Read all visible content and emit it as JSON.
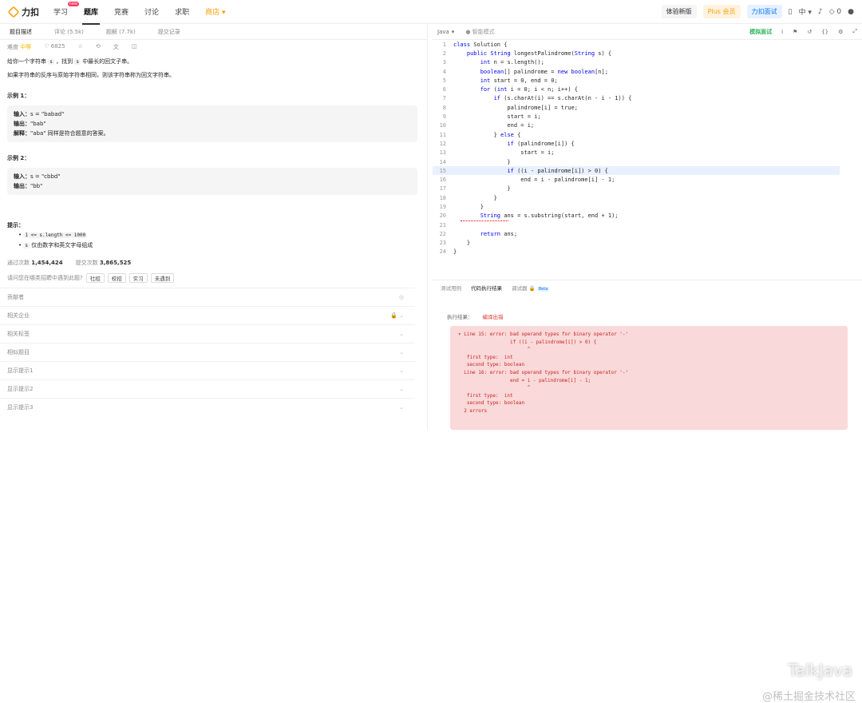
{
  "topbar": {
    "logo": "力扣",
    "nav": [
      "学习",
      "题库",
      "竞赛",
      "讨论",
      "求职",
      "商店"
    ],
    "new_badge": "new",
    "experience": "体验新版",
    "plus": "Plus 会员",
    "interview": "力扣面试",
    "lang": "中",
    "points": "0"
  },
  "left": {
    "tabs": [
      "题目描述",
      "评论 (5.5k)",
      "题解 (7.7k)",
      "提交记录"
    ],
    "difficulty_label": "难度",
    "difficulty": "中等",
    "likes": "6825",
    "description": [
      "给你一个字符串",
      "s",
      "，找到",
      "s",
      "中最长的回文子串。"
    ],
    "definition": "如果字符串的反序与原始字符串相同，则该字符串称为回文字符串。",
    "ex1_title": "示例 1：",
    "ex1": {
      "in_label": "输入：",
      "in": "s = \"babad\"",
      "out_label": "输出：",
      "out": "\"bab\"",
      "exp_label": "解释：",
      "exp": "\"aba\" 同样是符合题意的答案。"
    },
    "ex2_title": "示例 2：",
    "ex2": {
      "in_label": "输入：",
      "in": "s = \"cbbd\"",
      "out_label": "输出：",
      "out": "\"bb\""
    },
    "hint_title": "提示：",
    "hints": [
      "1 <= s.length <= 1000",
      "仅由数字和英文字母组成"
    ],
    "hint_s": "s",
    "pass_label": "通过次数",
    "pass_count": "1,454,424",
    "submit_label": "提交次数",
    "submit_count": "3,865,525",
    "question": "请问您在哪类招聘中遇到此题?",
    "tags": [
      "社招",
      "校招",
      "实习",
      "未遇到"
    ],
    "sections": [
      "贡献者",
      "相关企业",
      "相关标签",
      "相似题目",
      "显示提示1",
      "显示提示2",
      "显示提示3"
    ]
  },
  "editor": {
    "language": "Java",
    "mode": "智能模式",
    "mock": "模拟面试",
    "lines": [
      "class Solution {",
      "    public String longestPalindrome(String s) {",
      "        int n = s.length();",
      "        boolean[] palindrome = new boolean[n];",
      "        int start = 0, end = 0;",
      "        for (int i = 0; i < n; i++) {",
      "            if (s.charAt(i) == s.charAt(n - i - 1)) {",
      "                palindrome[i] = true;",
      "                start = i;",
      "                end = i;",
      "            } else {",
      "                if (palindrome[i]) {",
      "                    start = i;",
      "                }",
      "                if ((i - palindrome[i]) > 0) {",
      "                    end = i - palindrome[i] - 1;",
      "                }",
      "            }",
      "        }",
      "        String ans = s.substring(start, end + 1);",
      "",
      "        return ans;",
      "    }",
      "}"
    ]
  },
  "console": {
    "tabs": [
      "测试用例",
      "代码执行结果",
      "调试器"
    ],
    "beta": "Beta",
    "result_label": "执行结果：",
    "result": "编译出错",
    "error_text": "▾ Line 15: error: bad operand types for binary operator '-'\n                  if ((i - palindrome[i]) > 0) {\n                        ^\n   first type:  int\n   second type: boolean\n  Line 16: error: bad operand types for binary operator '-'\n                  end = i - palindrome[i] - 1;\n                        ^\n   first type:  int\n   second type: boolean\n  2 errors"
  },
  "watermark": {
    "brand": "TalkJava",
    "community": "@稀土掘金技术社区"
  }
}
